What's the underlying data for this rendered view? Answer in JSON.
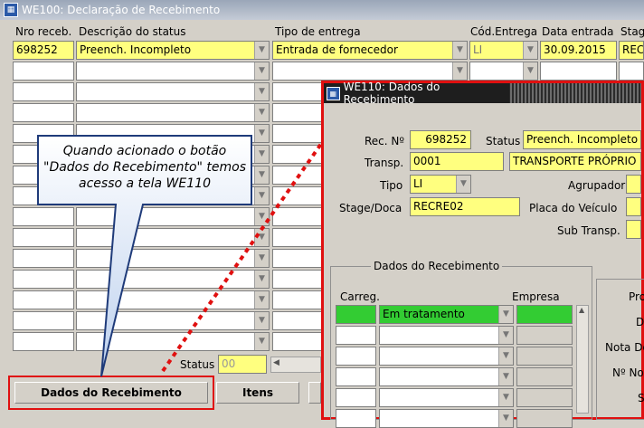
{
  "main_window": {
    "title": "WE100: Declaração de Recebimento",
    "columns": [
      "Nro receb.",
      "Descrição do status",
      "Tipo de entrega",
      "Cód.Entrega",
      "Data entrada",
      "Stag"
    ],
    "row1": {
      "nro": "698252",
      "descricao": "Preench. Incompleto",
      "tipo": "Entrada de fornecedor",
      "cod": "LI",
      "data": "30.09.2015",
      "stage": "REC"
    },
    "status_label": "Status",
    "status_value": "00",
    "buttons": {
      "dados": "Dados do Recebimento",
      "itens": "Itens"
    }
  },
  "callout": {
    "text": "Quando acionado o botão \"Dados do Recebimento\" temos acesso a tela WE110"
  },
  "we110": {
    "title": "WE110: Dados do Recebimento",
    "rec_label": "Rec. Nº",
    "rec_value": "698252",
    "status_label": "Status",
    "status_value": "Preench. Incompleto",
    "transp_label": "Transp.",
    "transp_code": "0001",
    "transp_name": "TRANSPORTE PRÓPRIO",
    "tipo_label": "Tipo",
    "tipo_value": "LI",
    "agrupador_label": "Agrupador",
    "stage_label": "Stage/Doca",
    "stage_value": "RECRE02",
    "placa_label": "Placa do Veículo",
    "sub_label": "Sub Transp.",
    "group_title": "Dados do Recebimento",
    "carreg_label": "Carreg.",
    "empresa_label": "Empresa",
    "em_tratamento": "Em tratamento",
    "right_labels": [
      "Pro",
      "D",
      "Nota De",
      "Nº Not",
      "S"
    ]
  },
  "colors": {
    "highlight": "#e01010",
    "yellow_field": "#ffff7f",
    "green_field": "#33cc33"
  }
}
